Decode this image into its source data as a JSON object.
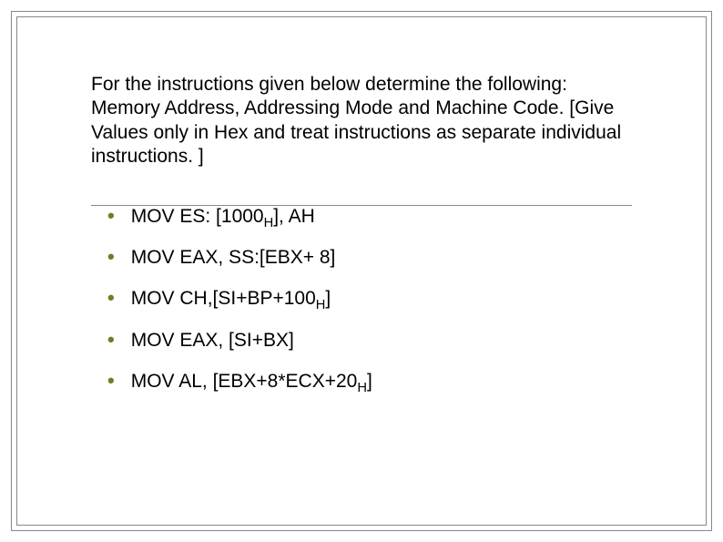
{
  "heading": "For the instructions given below determine the following: Memory Address, Addressing Mode and Machine Code. [Give Values only in Hex and treat instructions as separate individual instructions. ]",
  "items": [
    {
      "prefix": "MOV ES: [1000",
      "sub": "H",
      "suffix": "], AH"
    },
    {
      "prefix": "MOV EAX, SS:[EBX+ 8]",
      "sub": "",
      "suffix": ""
    },
    {
      "prefix": "MOV CH,[SI+BP+100",
      "sub": "H",
      "suffix": "]"
    },
    {
      "prefix": "MOV EAX, [SI+BX]",
      "sub": "",
      "suffix": ""
    },
    {
      "prefix": "MOV AL, [EBX+8*ECX+20",
      "sub": "H",
      "suffix": "]"
    }
  ],
  "bullet_char": "•"
}
